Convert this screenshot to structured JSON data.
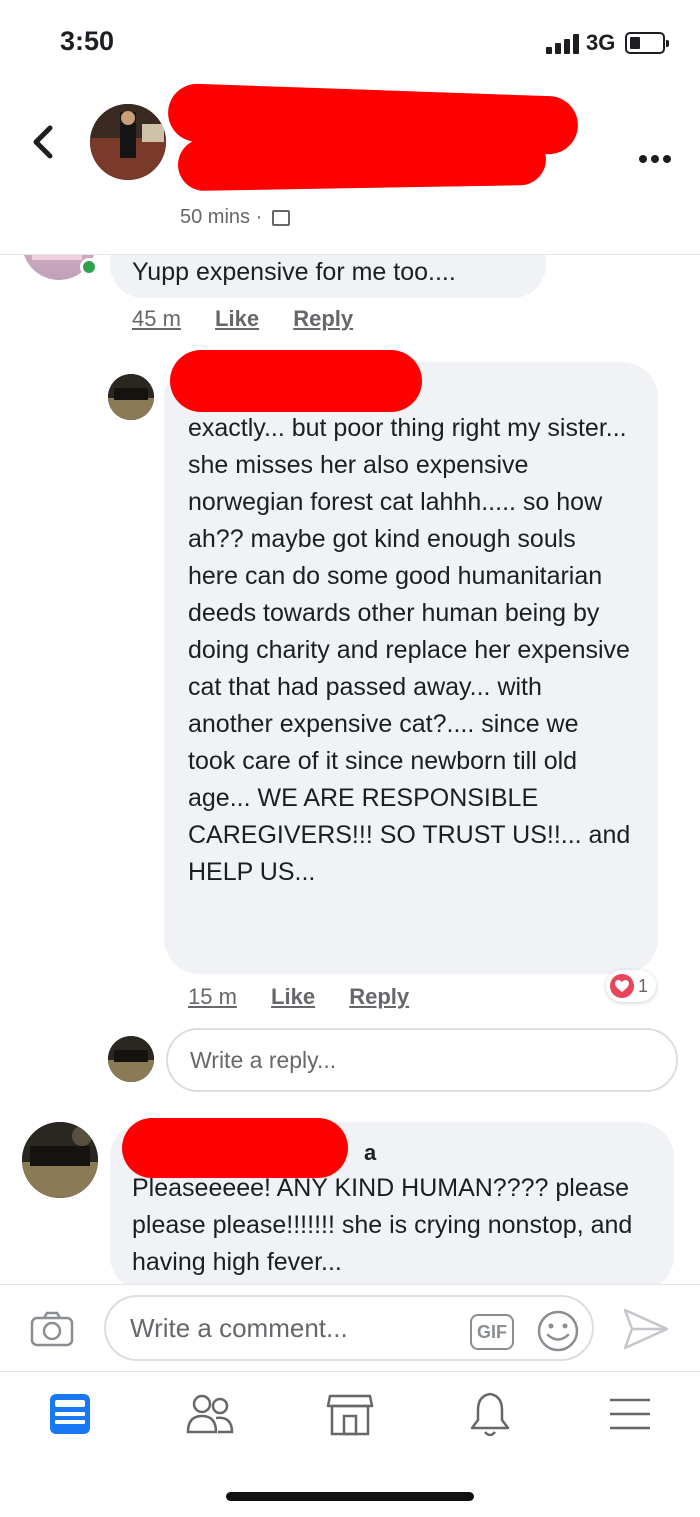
{
  "status_bar": {
    "time": "3:50",
    "network": "3G"
  },
  "header": {
    "meta_time": "50 mins",
    "meta_separator": "·",
    "group_icon": "group-privacy-icon"
  },
  "comments": [
    {
      "text": "Yupp expensive for me too....",
      "time": "45 m",
      "like_label": "Like",
      "reply_label": "Reply"
    },
    {
      "text": "exactly... but poor thing right my sister... she misses her also expensive norwegian forest cat lahhh..... so how ah?? maybe got kind enough souls here can do some good humanitarian deeds towards other human being by doing charity and replace her expensive cat that had passed away... with another expensive cat?.... since we took care of it since newborn till old age... WE ARE RESPONSIBLE CAREGIVERS!!! SO TRUST US!!... and HELP US...",
      "time": "15 m",
      "like_label": "Like",
      "reply_label": "Reply",
      "reaction_count": "1"
    },
    {
      "name_visible_fragment": "a",
      "text": "Pleaseeeee! ANY KIND HUMAN???? please please please!!!!!!! she is crying nonstop, and having high fever..."
    }
  ],
  "reply_box": {
    "placeholder": "Write a reply..."
  },
  "composer": {
    "placeholder": "Write a comment...",
    "gif_label": "GIF"
  },
  "icons": {
    "back": "chevron-left-icon",
    "more": "more-horizontal-icon",
    "camera": "camera-icon",
    "emoji": "smiley-icon",
    "send": "send-icon",
    "heart": "heart-icon"
  },
  "tabs": [
    "news-feed-icon",
    "friends-icon",
    "marketplace-icon",
    "notifications-icon",
    "menu-icon"
  ],
  "colors": {
    "accent": "#1877f2",
    "bubble": "#f0f2f5",
    "secondary_text": "#65676b",
    "redaction": "#ff0000",
    "online": "#31a24c",
    "heart": "#e8445a"
  }
}
